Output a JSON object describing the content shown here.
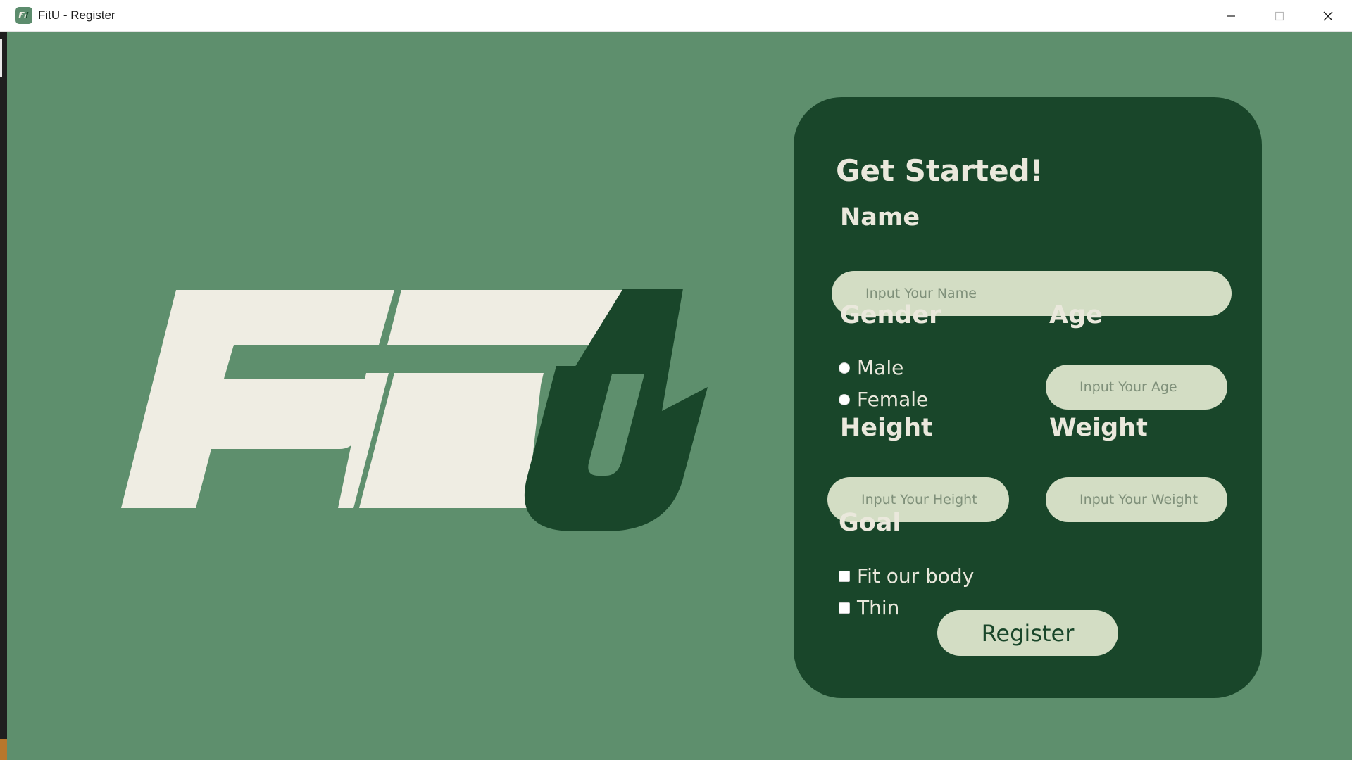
{
  "window": {
    "title": "FitU - Register",
    "icon": "fitu-app-icon",
    "controls": [
      "minimize-icon",
      "maximize-icon",
      "close-icon"
    ]
  },
  "colors": {
    "background": "#5e8f6d",
    "card": "#19462a",
    "input_fill": "#d3ddc4",
    "text_light": "#eae8dc",
    "logo_cream": "#efede3",
    "logo_green": "#19462a"
  },
  "logo": {
    "text": "FitU"
  },
  "form": {
    "title": "Get Started!",
    "name_label": "Name",
    "name_placeholder": "Input Your Name",
    "gender_label": "Gender",
    "gender_options": [
      "Male",
      "Female"
    ],
    "age_label": "Age",
    "age_placeholder": "Input Your Age",
    "height_label": "Height",
    "height_placeholder": "Input Your Height",
    "weight_label": "Weight",
    "weight_placeholder": "Input Your Weight",
    "goal_label": "Goal",
    "goal_options": [
      "Fit our body",
      "Thin"
    ],
    "register_label": "Register"
  }
}
